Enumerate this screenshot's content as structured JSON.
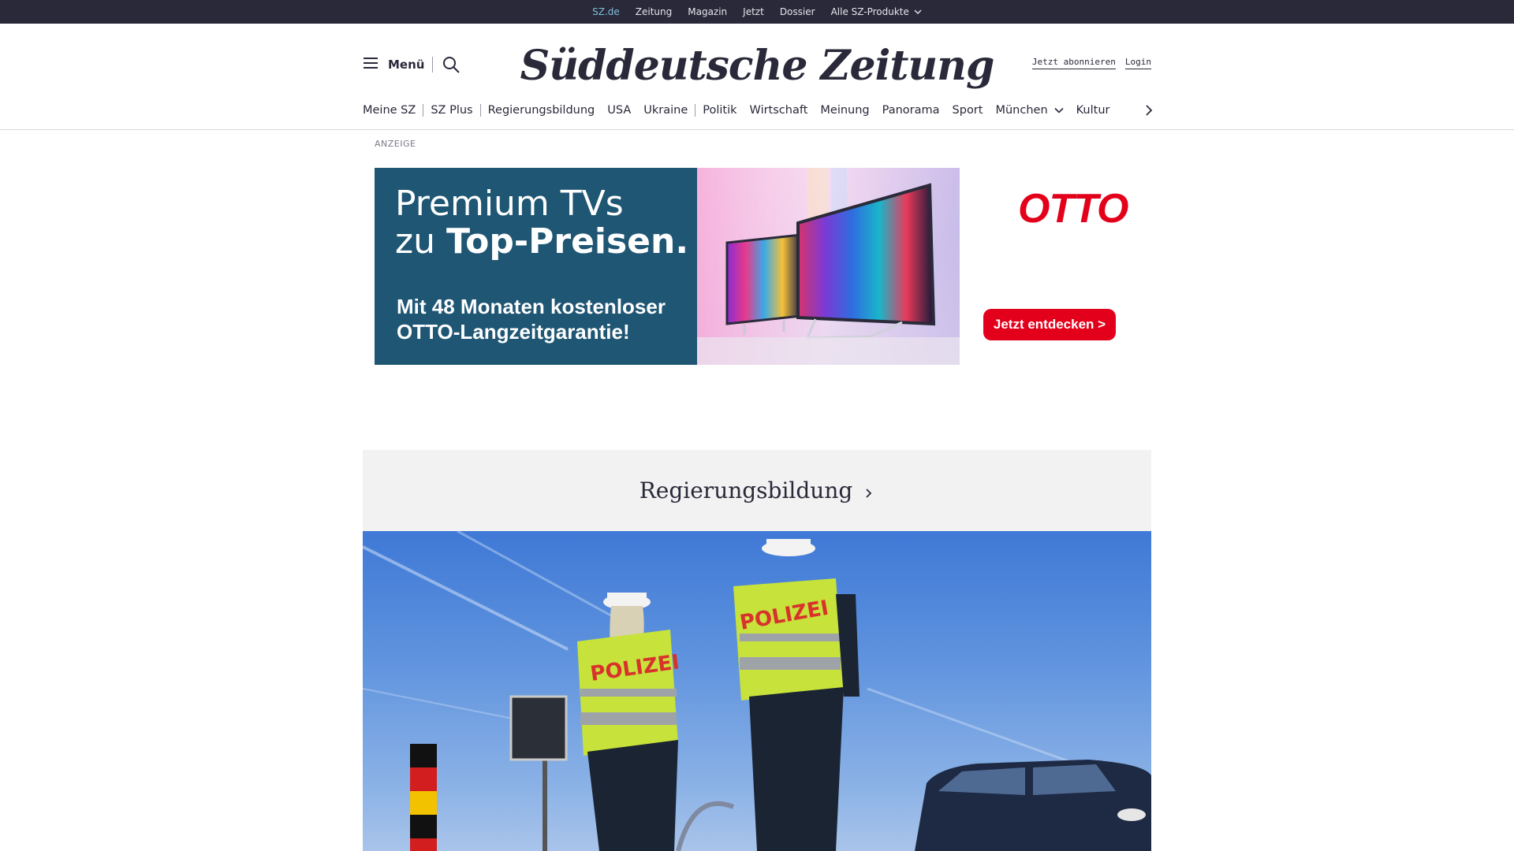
{
  "topbar": {
    "links": [
      {
        "label": "SZ.de",
        "active": true
      },
      {
        "label": "Zeitung",
        "active": false
      },
      {
        "label": "Magazin",
        "active": false
      },
      {
        "label": "Jetzt",
        "active": false
      },
      {
        "label": "Dossier",
        "active": false
      },
      {
        "label": "Alle SZ-Produkte",
        "active": false,
        "icon": "chevron-down-icon"
      }
    ]
  },
  "header": {
    "menu_label": "Menü",
    "logo_text": "Süddeutsche Zeitung",
    "subscribe_label": "Jetzt abonnieren",
    "login_label": "Login"
  },
  "nav": {
    "items": [
      "Meine SZ",
      "SZ Plus",
      "Regierungsbildung",
      "USA",
      "Ukraine",
      "Politik",
      "Wirtschaft",
      "Meinung",
      "Panorama",
      "Sport",
      "München",
      "Kultur"
    ]
  },
  "ad": {
    "label": "ANZEIGE",
    "headline_line1": "Premium TVs",
    "headline_line2_prefix": "zu ",
    "headline_line2_bold": "Top-Preisen.",
    "subline": "Mit 48 Monaten kostenloser OTTO-Langzeitgarantie!",
    "brand": "OTTO",
    "cta": "Jetzt entdecken >"
  },
  "topic": {
    "title": "Regierungsbildung"
  },
  "hero": {
    "police_text": "POLIZEI"
  },
  "colors": {
    "topbar_bg": "#29293a",
    "active_link": "#7fc1d9",
    "ad_blue": "#1f5673",
    "otto_red": "#e3001b",
    "topic_bg": "#f2f2f2"
  }
}
